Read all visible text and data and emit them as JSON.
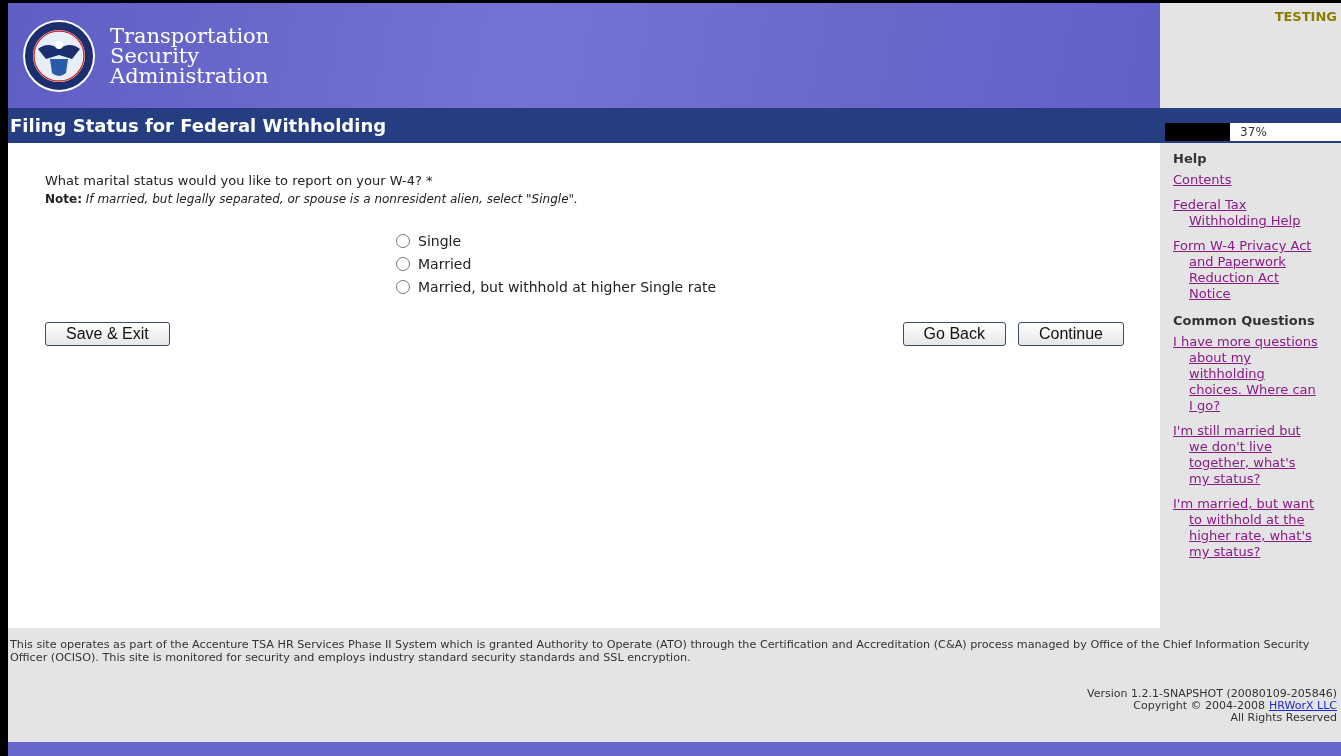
{
  "header": {
    "org_name": [
      "Transportation",
      "Security",
      "Administration"
    ],
    "environment_badge": "TESTING"
  },
  "title_bar": {
    "title": "Filing Status for Federal Withholding",
    "progress": {
      "level": 0.37,
      "reading": "37%"
    }
  },
  "question": {
    "prompt": "What marital status would you like to report on your W-4? *",
    "note": "**Note:** *If married, but legally separated, or spouse is a nonresident alien, select \"Single\".*"
  },
  "options": [
    {
      "label": "Single",
      "selected": false
    },
    {
      "label": "Married",
      "selected": false
    },
    {
      "label": "Married, but withhold at higher Single rate",
      "selected": false
    }
  ],
  "buttons": {
    "left": [
      "Save & Exit"
    ],
    "right": [
      "Go Back",
      "Continue"
    ]
  },
  "sidebar": {
    "sections": [
      {
        "heading": "Help",
        "links": [
          "Contents",
          "Federal Tax Withholding Help",
          "Form W-4 Privacy Act and Paperwork Reduction Act Notice"
        ]
      },
      {
        "heading": "Common Questions",
        "links": [
          "I have more questions about my withholding choices. Where can I go?",
          "I'm still married but we don't live together, what's my status?",
          "I'm married, but want to withhold at the higher rate, what's my status?"
        ]
      }
    ]
  },
  "footer": {
    "notice": "This site operates as part of the Accenture TSA HR Services Phase II System which is granted Authority to Operate (ATO) through the Certification and Accreditation (C&A) process managed by Office of the Chief Information Security Officer (OCISO). This site is monitored for security and employs industry standard security standards and SSL encryption.",
    "version": "Version 1.2.1-SNAPSHOT (20080109-205846)",
    "copyright": "Copyright © 2004-2008",
    "company_link": "HRWorX LLC",
    "rights": "All Rights Reserved"
  }
}
